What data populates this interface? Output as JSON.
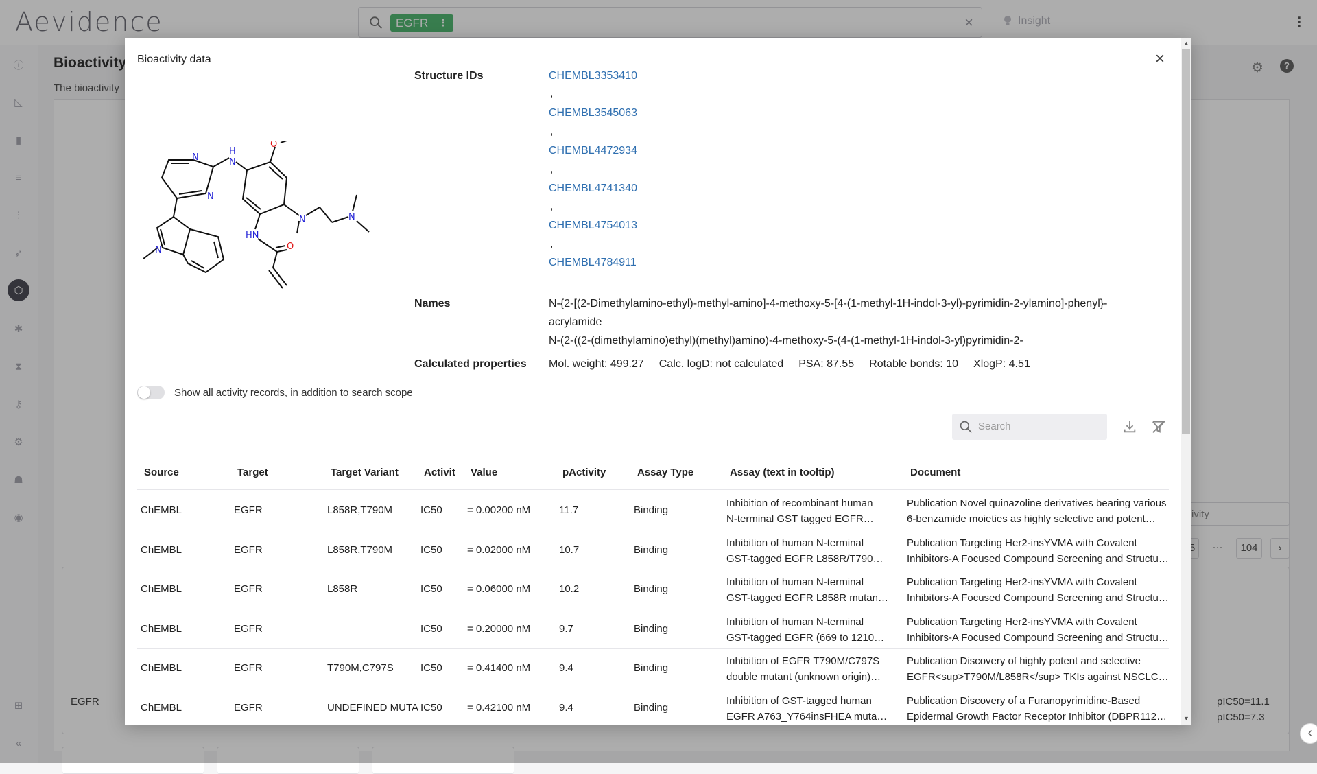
{
  "app": {
    "logo": "Aevidence",
    "search_chip": "EGFR",
    "chip_menu": "⋮",
    "clear": "×",
    "insight": "Insight",
    "menu": "⋮"
  },
  "background": {
    "title": "Bioactivity",
    "subtitle": "The bioactivity",
    "select_value": "ivity",
    "page_partial": "5",
    "page_ellipsis": "···",
    "page_last": "104",
    "page_next": "›",
    "card_label": "EGFR",
    "pic_1": "pIC50=11.1",
    "pic_2": "pIC50=7.3",
    "help": "?",
    "collapse": "«",
    "expand_arrow": "‹"
  },
  "modal": {
    "title": "Bioactivity data",
    "close": "×",
    "structure_ids_label": "Structure IDs",
    "structure_ids": [
      "CHEMBL3353410",
      "CHEMBL3545063",
      "CHEMBL4472934",
      "CHEMBL4741340",
      "CHEMBL4754013",
      "CHEMBL4784911"
    ],
    "separator": ",",
    "names_label": "Names",
    "names": [
      "N-{2-[(2-Dimethylamino-ethyl)-methyl-amino]-4-methoxy-5-[4-(1-methyl-1H-indol-3-yl)-pyrimidin-2-ylamino]-phenyl}-",
      "acrylamide",
      "N-(2-((2-(dimethylamino)ethyl)(methyl)amino)-4-methoxy-5-(4-(1-methyl-1H-indol-3-yl)pyrimidin-2-"
    ],
    "calc_label": "Calculated properties",
    "calc": {
      "mol_weight": "Mol. weight: 499.27",
      "logd": "Calc. logD: not calculated",
      "psa": "PSA: 87.55",
      "rot_bonds": "Rotable bonds: 10",
      "xlogp": "XlogP: 4.51"
    },
    "toggle_label": "Show all activity records, in addition to search scope",
    "search_placeholder": "Search"
  },
  "table": {
    "headers": [
      "Source",
      "Target",
      "Target Variant",
      "Activit",
      "Value",
      "pActivity",
      "Assay Type",
      "Assay (text in tooltip)",
      "Document"
    ],
    "rows": [
      {
        "source": "ChEMBL",
        "target": "EGFR",
        "variant": "L858R,T790M",
        "activity": "IC50",
        "value": "= 0.00200 nM",
        "pactivity": "11.7",
        "assay_type": "Binding",
        "assay_1": "Inhibition of recombinant human",
        "assay_2": "N-terminal GST tagged EGFR…",
        "doc_1": "Publication Novel quinazoline derivatives bearing various",
        "doc_2": "6-benzamide moieties as highly selective and potent…"
      },
      {
        "source": "ChEMBL",
        "target": "EGFR",
        "variant": "L858R,T790M",
        "activity": "IC50",
        "value": "= 0.02000 nM",
        "pactivity": "10.7",
        "assay_type": "Binding",
        "assay_1": "Inhibition of human N-terminal",
        "assay_2": "GST-tagged EGFR L858R/T790M…",
        "doc_1": "Publication Targeting Her2-insYVMA with Covalent",
        "doc_2": "Inhibitors-A Focused Compound Screening and Structur…"
      },
      {
        "source": "ChEMBL",
        "target": "EGFR",
        "variant": "L858R",
        "activity": "IC50",
        "value": "= 0.06000 nM",
        "pactivity": "10.2",
        "assay_type": "Binding",
        "assay_1": "Inhibition of human N-terminal",
        "assay_2": "GST-tagged EGFR L858R mutant…",
        "doc_1": "Publication Targeting Her2-insYVMA with Covalent",
        "doc_2": "Inhibitors-A Focused Compound Screening and Structur…"
      },
      {
        "source": "ChEMBL",
        "target": "EGFR",
        "variant": "",
        "activity": "IC50",
        "value": "= 0.20000 nM",
        "pactivity": "9.7",
        "assay_type": "Binding",
        "assay_1": "Inhibition of human N-terminal",
        "assay_2": "GST-tagged EGFR (669 to 1210…",
        "doc_1": "Publication Targeting Her2-insYVMA with Covalent",
        "doc_2": "Inhibitors-A Focused Compound Screening and Structur…"
      },
      {
        "source": "ChEMBL",
        "target": "EGFR",
        "variant": "T790M,C797S",
        "activity": "IC50",
        "value": "= 0.41400 nM",
        "pactivity": "9.4",
        "assay_type": "Binding",
        "assay_1": "Inhibition of EGFR T790M/C797S",
        "assay_2": "double mutant (unknown origin)…",
        "doc_1": "Publication Discovery of highly potent and selective",
        "doc_2": "EGFR<sup>T790M/L858R</sup> TKIs against NSCLC…"
      },
      {
        "source": "ChEMBL",
        "target": "EGFR",
        "variant": "UNDEFINED MUTA",
        "activity": "IC50",
        "value": "= 0.42100 nM",
        "pactivity": "9.4",
        "assay_type": "Binding",
        "assay_1": "Inhibition of GST-tagged human",
        "assay_2": "EGFR A763_Y764insFHEA muta…",
        "doc_1": "Publication Discovery of a Furanopyrimidine-Based",
        "doc_2": "Epidermal Growth Factor Receptor Inhibitor (DBPR112) a…"
      }
    ]
  },
  "molecule_atoms": [
    "N",
    "N",
    "H",
    "N",
    "O",
    "N",
    "HN",
    "O",
    "N",
    "N"
  ],
  "colors": {
    "accent_green": "#53b874",
    "link_blue": "#2f6fb0",
    "nitrogen": "#1f1fd6",
    "oxygen": "#e01515"
  }
}
